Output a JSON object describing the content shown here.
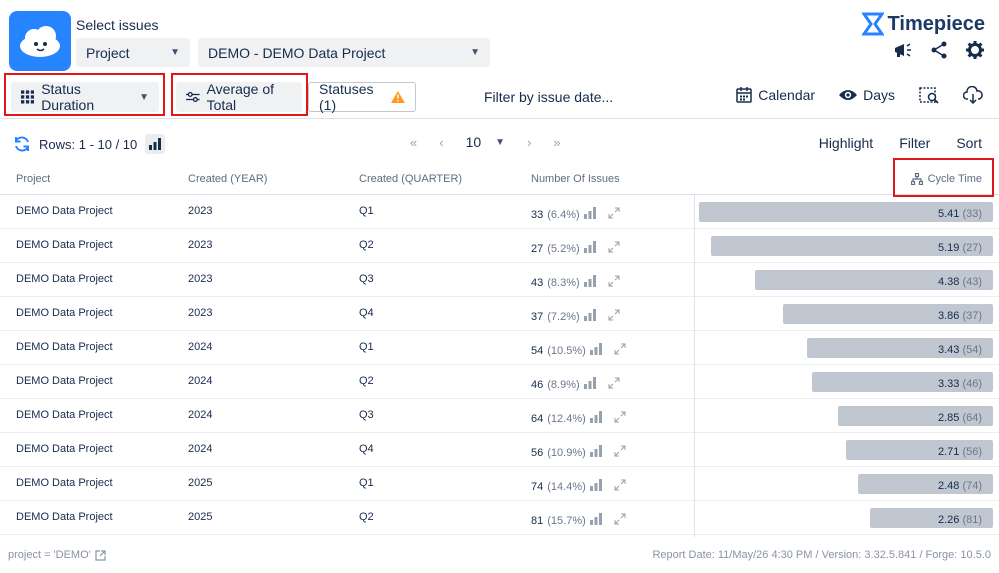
{
  "header": {
    "select_label": "Select issues",
    "project_dropdown": "Project",
    "data_dropdown": "DEMO - DEMO Data Project",
    "brand": "Timepiece"
  },
  "toolbar": {
    "status_duration": "Status Duration",
    "average_of_total": "Average of Total",
    "statuses": "Statuses (1)",
    "filter_by_date": "Filter by issue date...",
    "calendar": "Calendar",
    "days": "Days"
  },
  "pager": {
    "rows": "Rows: 1 - 10 / 10",
    "page_size": "10"
  },
  "actions": {
    "highlight": "Highlight",
    "filter": "Filter",
    "sort": "Sort"
  },
  "table": {
    "headers": {
      "project": "Project",
      "year": "Created (YEAR)",
      "quarter": "Created (QUARTER)",
      "issues": "Number Of Issues",
      "cycle": "Cycle Time"
    },
    "rows": [
      {
        "project": "DEMO Data Project",
        "year": "2023",
        "quarter": "Q1",
        "count": "33",
        "pct": "(6.4%)",
        "cycle": "5.41",
        "cycle_count": "(33)",
        "value": 5.41
      },
      {
        "project": "DEMO Data Project",
        "year": "2023",
        "quarter": "Q2",
        "count": "27",
        "pct": "(5.2%)",
        "cycle": "5.19",
        "cycle_count": "(27)",
        "value": 5.19
      },
      {
        "project": "DEMO Data Project",
        "year": "2023",
        "quarter": "Q3",
        "count": "43",
        "pct": "(8.3%)",
        "cycle": "4.38",
        "cycle_count": "(43)",
        "value": 4.38
      },
      {
        "project": "DEMO Data Project",
        "year": "2023",
        "quarter": "Q4",
        "count": "37",
        "pct": "(7.2%)",
        "cycle": "3.86",
        "cycle_count": "(37)",
        "value": 3.86
      },
      {
        "project": "DEMO Data Project",
        "year": "2024",
        "quarter": "Q1",
        "count": "54",
        "pct": "(10.5%)",
        "cycle": "3.43",
        "cycle_count": "(54)",
        "value": 3.43
      },
      {
        "project": "DEMO Data Project",
        "year": "2024",
        "quarter": "Q2",
        "count": "46",
        "pct": "(8.9%)",
        "cycle": "3.33",
        "cycle_count": "(46)",
        "value": 3.33
      },
      {
        "project": "DEMO Data Project",
        "year": "2024",
        "quarter": "Q3",
        "count": "64",
        "pct": "(12.4%)",
        "cycle": "2.85",
        "cycle_count": "(64)",
        "value": 2.85
      },
      {
        "project": "DEMO Data Project",
        "year": "2024",
        "quarter": "Q4",
        "count": "56",
        "pct": "(10.9%)",
        "cycle": "2.71",
        "cycle_count": "(56)",
        "value": 2.71
      },
      {
        "project": "DEMO Data Project",
        "year": "2025",
        "quarter": "Q1",
        "count": "74",
        "pct": "(14.4%)",
        "cycle": "2.48",
        "cycle_count": "(74)",
        "value": 2.48
      },
      {
        "project": "DEMO Data Project",
        "year": "2025",
        "quarter": "Q2",
        "count": "81",
        "pct": "(15.7%)",
        "cycle": "2.26",
        "cycle_count": "(81)",
        "value": 2.26
      }
    ]
  },
  "footer": {
    "query": "project = 'DEMO'",
    "report": "Report Date: 11/May/26 4:30 PM / Version: 3.32.5.841 / Forge: 10.5.0"
  },
  "colors": {
    "accent": "#2684ff",
    "highlight_border": "#e0161b",
    "bar": "#c1c7d0"
  }
}
